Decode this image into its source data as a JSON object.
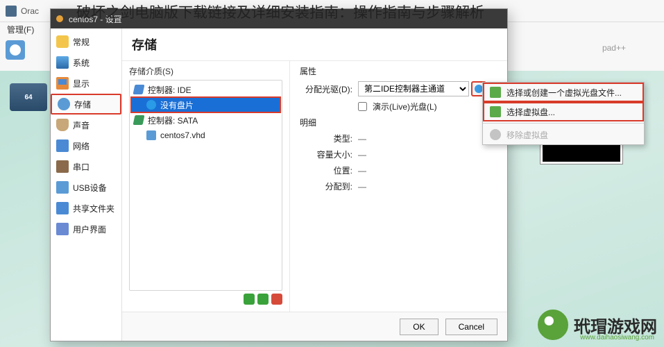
{
  "article_title": "破坏之剑电脑版下载链接及详细安装指南：操作指南与步骤解析",
  "parent": {
    "title": "Orac",
    "menu_manage": "管理(F)",
    "npp": "pad++",
    "vm_badge": "64"
  },
  "dialog": {
    "title": "centos7 - 设置",
    "sidebar": {
      "general": "常规",
      "system": "系统",
      "display": "显示",
      "storage": "存储",
      "audio": "声音",
      "network": "网络",
      "serial": "串口",
      "usb": "USB设备",
      "shared": "共享文件夹",
      "ui": "用户界面"
    },
    "main_header": "存储",
    "storage": {
      "media_label": "存储介质(S)",
      "tree": {
        "ide": "控制器: IDE",
        "empty": "没有盘片",
        "sata": "控制器: SATA",
        "vhd": "centos7.vhd"
      }
    },
    "props": {
      "attributes": "属性",
      "alloc_drive": "分配光驱(D):",
      "drive_value": "第二IDE控制器主通道",
      "live_cd": "演示(Live)光盘(L)",
      "details": "明细",
      "type": "类型:",
      "size": "容量大小:",
      "location": "位置:",
      "allocated": "分配到:",
      "dash": "—"
    },
    "footer": {
      "ok": "OK",
      "cancel": "Cancel"
    }
  },
  "menu": {
    "create": "选择或创建一个虚拟光盘文件...",
    "select": "选择虚拟盘...",
    "remove": "移除虚拟盘"
  },
  "watermark": {
    "text": "玳瑁游戏网",
    "sub": "www.daihaosiwang.com"
  }
}
